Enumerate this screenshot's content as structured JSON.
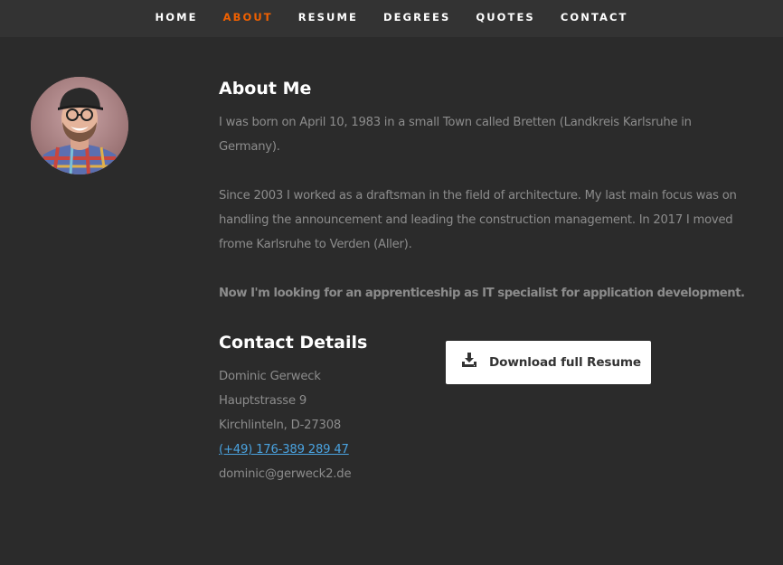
{
  "nav": {
    "items": [
      {
        "label": "HOME"
      },
      {
        "label": "ABOUT"
      },
      {
        "label": "RESUME"
      },
      {
        "label": "DEGREES"
      },
      {
        "label": "QUOTES"
      },
      {
        "label": "CONTACT"
      }
    ],
    "active": "ABOUT"
  },
  "about": {
    "title": "About Me",
    "paragraphs": [
      "I was born on April 10, 1983 in a small Town called Bretten (Landkreis Karlsruhe in Germany).",
      "Since 2003 I worked as a draftsman in the field of architecture. My last main focus was on handling the announcement and leading the construction management. In 2017 I moved frome Karlsruhe to Verden (Aller).",
      "Now I'm looking for an apprenticeship as IT specialist for application development."
    ]
  },
  "contact": {
    "title": "Contact Details",
    "name": "Dominic Gerweck",
    "street": "Hauptstrasse 9",
    "city": "Kirchlinteln, D-27308",
    "phone": "(+49) 176-389 289 47",
    "email": "dominic@gerweck2.de"
  },
  "download": {
    "label": "Download full Resume",
    "icon": "download-icon"
  },
  "colors": {
    "background": "#2b2b2b",
    "navbar": "#333333",
    "accent": "#f06000",
    "link": "#4aa3e0",
    "muted_text": "#8c8c8c"
  }
}
